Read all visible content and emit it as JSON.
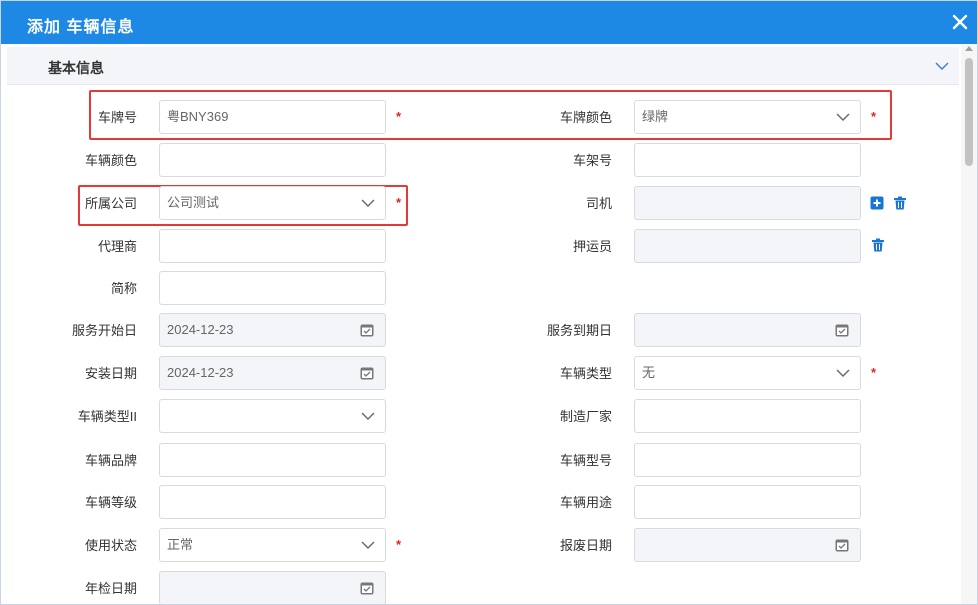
{
  "dialog": {
    "title": "添加 车辆信息"
  },
  "section": {
    "title": "基本信息"
  },
  "fields": {
    "plate_no": {
      "label": "车牌号",
      "value": "粤BNY369"
    },
    "plate_color": {
      "label": "车牌颜色",
      "value": "绿牌"
    },
    "vehicle_color": {
      "label": "车辆颜色",
      "value": ""
    },
    "frame_no": {
      "label": "车架号",
      "value": ""
    },
    "company": {
      "label": "所属公司",
      "value": "公司测试"
    },
    "driver": {
      "label": "司机",
      "value": ""
    },
    "agent": {
      "label": "代理商",
      "value": ""
    },
    "escort": {
      "label": "押运员",
      "value": ""
    },
    "short_name": {
      "label": "简称",
      "value": ""
    },
    "service_start": {
      "label": "服务开始日",
      "value": "2024-12-23"
    },
    "service_end": {
      "label": "服务到期日",
      "value": ""
    },
    "install_date": {
      "label": "安装日期",
      "value": "2024-12-23"
    },
    "vehicle_type": {
      "label": "车辆类型",
      "value": "无"
    },
    "vehicle_type2": {
      "label": "车辆类型II",
      "value": ""
    },
    "manufacturer": {
      "label": "制造厂家",
      "value": ""
    },
    "brand": {
      "label": "车辆品牌",
      "value": ""
    },
    "model": {
      "label": "车辆型号",
      "value": ""
    },
    "grade": {
      "label": "车辆等级",
      "value": ""
    },
    "usage": {
      "label": "车辆用途",
      "value": ""
    },
    "status": {
      "label": "使用状态",
      "value": "正常"
    },
    "scrap_date": {
      "label": "报废日期",
      "value": ""
    },
    "inspection_date": {
      "label": "年检日期",
      "value": ""
    }
  },
  "required_mark": "*",
  "colors": {
    "titlebar": "#1e88e5",
    "required": "#e02424",
    "highlight": "#e53935",
    "icon": "#1976d2"
  }
}
